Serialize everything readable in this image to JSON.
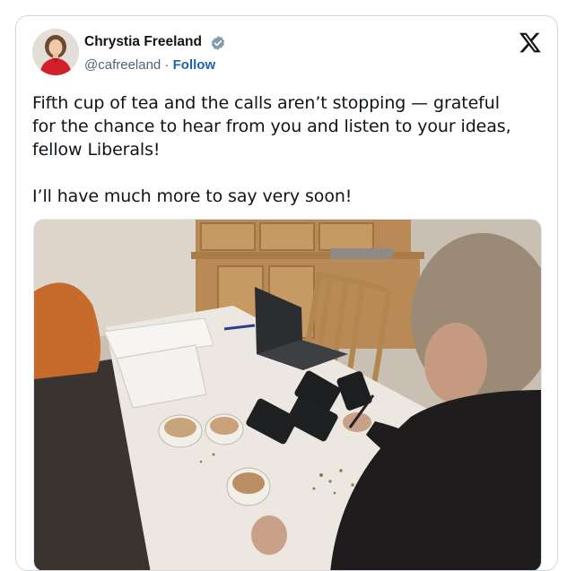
{
  "tweet": {
    "author": {
      "name": "Chrystia Freeland",
      "handle": "@cafreeland",
      "separator": "·",
      "follow_label": "Follow",
      "verified": true,
      "avatar_icon": "profile-photo"
    },
    "platform_icon": "x-logo-icon",
    "text": {
      "line1": "Fifth cup of tea and the calls aren’t stopping — grateful",
      "line2": "for the chance to hear from you and listen to your ideas,",
      "line3": "fellow Liberals!",
      "para2": "I’ll have much more to say very soon!"
    },
    "media": {
      "kind": "photo"
    }
  },
  "colors": {
    "link": "#1d64a8",
    "verified_badge": "#829aab",
    "muted_text": "#536471",
    "border": "#cfd9de"
  }
}
